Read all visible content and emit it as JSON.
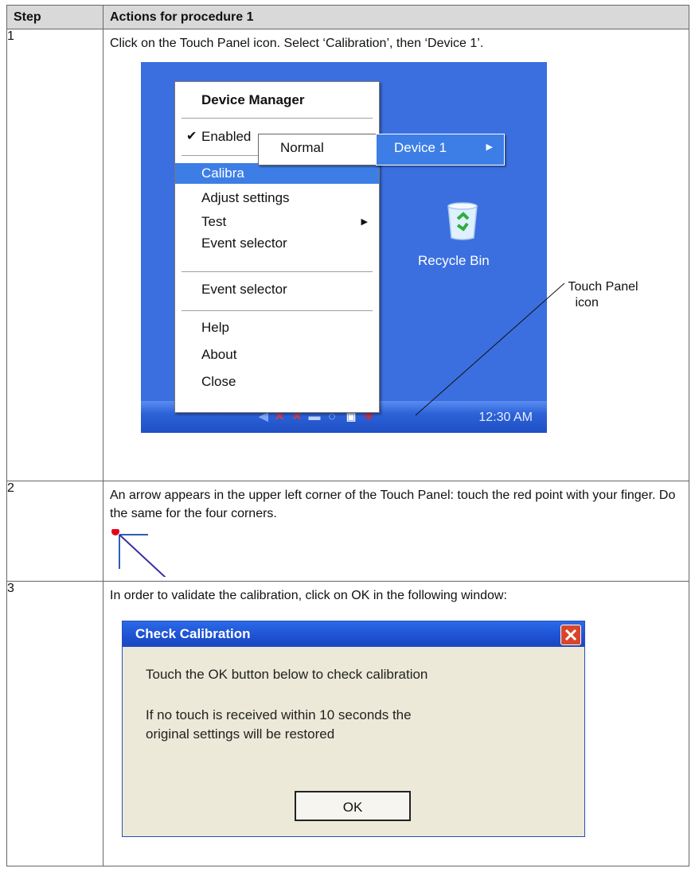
{
  "table": {
    "header_step": "Step",
    "header_actions": "Actions for procedure 1"
  },
  "step1": {
    "number": "1",
    "text": "Click on the Touch Panel icon. Select ‘Calibration’, then ‘Device 1’.",
    "menu": {
      "title": "Device Manager",
      "enabled": "Enabled",
      "calibration": "Calibra",
      "adjust": "Adjust settings",
      "test": "Test",
      "event1": "Event selector",
      "event2": "Event selector",
      "help": "Help",
      "about": "About",
      "close": "Close"
    },
    "submenu1": "Normal",
    "submenu2": "Device 1",
    "recycle_bin": "Recycle Bin",
    "clock": "12:30 AM",
    "callout_line1": "Touch Panel",
    "callout_line2": "icon",
    "colors": {
      "desktop": "#3b6fe0",
      "highlight": "#3d7ee6"
    }
  },
  "step2": {
    "number": "2",
    "text": "An arrow appears in the upper left corner of the Touch Panel: touch the red point with your finger. Do the same for the four corners.",
    "colors": {
      "point": "#e8001c",
      "arrow": "#3a2fa5",
      "guide": "#2b5fb5"
    }
  },
  "step3": {
    "number": "3",
    "text": "In order to validate the calibration, click on OK in the following window:",
    "dialog": {
      "title": "Check Calibration",
      "line1": "Touch the OK button below to check calibration",
      "line2": "If no touch is received within 10 seconds the",
      "line3": "original settings will be restored",
      "ok": "OK"
    }
  }
}
